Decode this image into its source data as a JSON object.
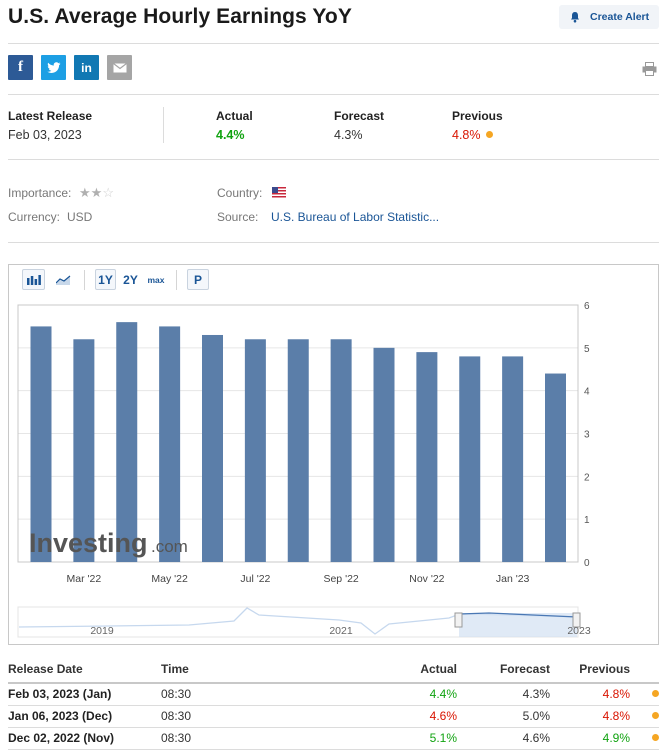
{
  "page": {
    "title": "U.S. Average Hourly Earnings YoY",
    "create_alert_label": "Create Alert"
  },
  "release": {
    "latest_label": "Latest Release",
    "latest_date": "Feb 03, 2023",
    "actual_label": "Actual",
    "actual_value": "4.4%",
    "forecast_label": "Forecast",
    "forecast_value": "4.3%",
    "previous_label": "Previous",
    "previous_value": "4.8%"
  },
  "details": {
    "importance_label": "Importance:",
    "importance_stars": 2,
    "country_label": "Country:",
    "currency_label": "Currency:",
    "currency_value": "USD",
    "source_label": "Source:",
    "source_value": "U.S. Bureau of Labor Statistic..."
  },
  "toolbar": {
    "range_1y": "1Y",
    "range_2y": "2Y",
    "range_max": "max",
    "p_label": "P"
  },
  "watermark": {
    "brand": "Investing",
    "suffix": ".com"
  },
  "chart_data": {
    "type": "bar",
    "values": [
      5.5,
      5.2,
      5.6,
      5.5,
      5.3,
      5.2,
      5.2,
      5.2,
      5.0,
      4.9,
      4.8,
      4.8,
      4.4
    ],
    "x_tick_labels": [
      "Mar '22",
      "May '22",
      "Jul '22",
      "Sep '22",
      "Nov '22",
      "Jan '23"
    ],
    "y_ticks": [
      0,
      1,
      2,
      3,
      4,
      5,
      6
    ],
    "ylim": [
      0,
      6
    ],
    "grid": true,
    "color": "#5b7ea9",
    "navigator_labels": [
      "2019",
      "2021",
      "2023"
    ]
  },
  "history": {
    "headers": {
      "date": "Release Date",
      "time": "Time",
      "actual": "Actual",
      "forecast": "Forecast",
      "previous": "Previous"
    },
    "rows": [
      {
        "date": "Feb 03, 2023 (Jan)",
        "time": "08:30",
        "actual": "4.4%",
        "actual_color": "#11a311",
        "forecast": "4.3%",
        "previous": "4.8%",
        "previous_color": "#d91400"
      },
      {
        "date": "Jan 06, 2023 (Dec)",
        "time": "08:30",
        "actual": "4.6%",
        "actual_color": "#d91400",
        "forecast": "5.0%",
        "previous": "4.8%",
        "previous_color": "#d91400"
      },
      {
        "date": "Dec 02, 2022 (Nov)",
        "time": "08:30",
        "actual": "5.1%",
        "actual_color": "#11a311",
        "forecast": "4.6%",
        "previous": "4.9%",
        "previous_color": "#11a311"
      }
    ]
  }
}
